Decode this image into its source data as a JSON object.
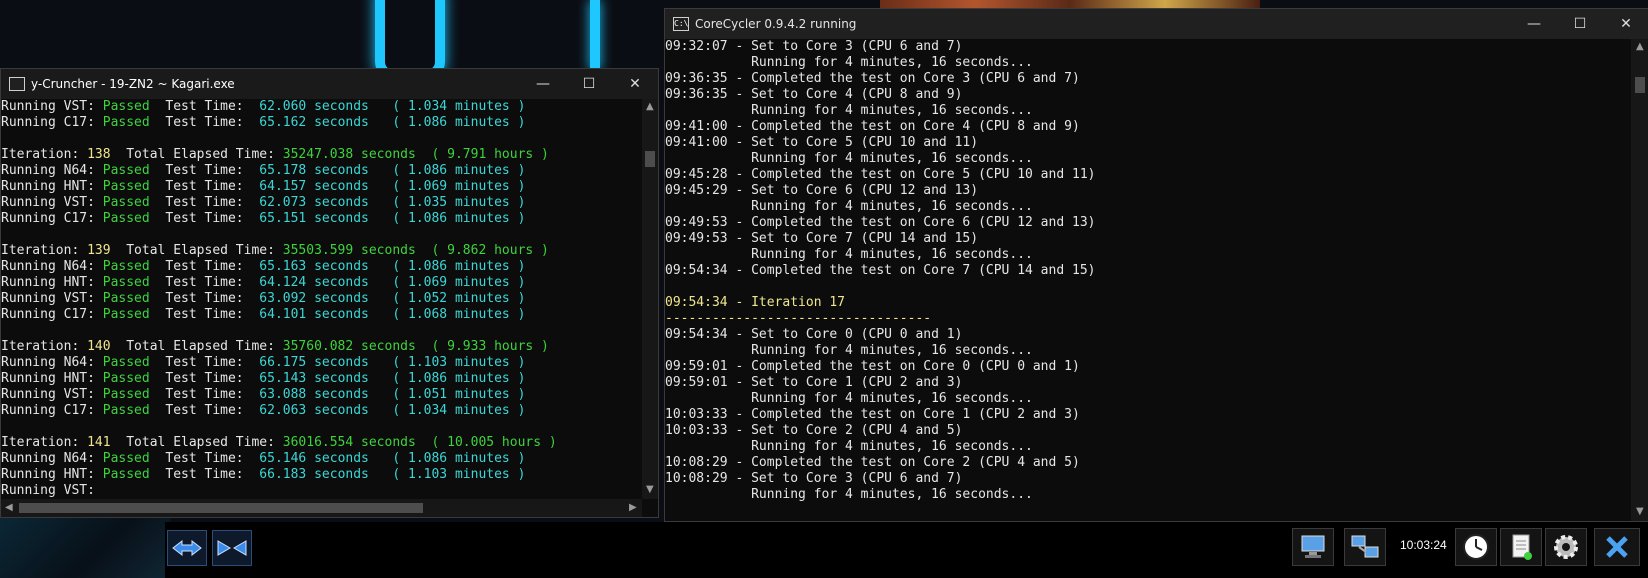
{
  "ycruncher": {
    "title": "y-Cruncher - 19-ZN2 ~ Kagari.exe",
    "lines": [
      [
        [
          "Running VST: ",
          "w"
        ],
        [
          "Passed",
          "g"
        ],
        [
          "  Test Time:  ",
          "w"
        ],
        [
          "62.060 seconds   ( 1.034 minutes )",
          "c"
        ]
      ],
      [
        [
          "Running C17: ",
          "w"
        ],
        [
          "Passed",
          "g"
        ],
        [
          "  Test Time:  ",
          "w"
        ],
        [
          "65.162 seconds   ( 1.086 minutes )",
          "c"
        ]
      ],
      [],
      [
        [
          "Iteration: ",
          "w"
        ],
        [
          "138",
          "y"
        ],
        [
          "  Total Elapsed Time: ",
          "w"
        ],
        [
          "35247.038 seconds",
          "g"
        ],
        [
          "  ( 9.791 hours )",
          "g"
        ]
      ],
      [
        [
          "Running N64: ",
          "w"
        ],
        [
          "Passed",
          "g"
        ],
        [
          "  Test Time:  ",
          "w"
        ],
        [
          "65.178 seconds   ( 1.086 minutes )",
          "c"
        ]
      ],
      [
        [
          "Running HNT: ",
          "w"
        ],
        [
          "Passed",
          "g"
        ],
        [
          "  Test Time:  ",
          "w"
        ],
        [
          "64.157 seconds   ( 1.069 minutes )",
          "c"
        ]
      ],
      [
        [
          "Running VST: ",
          "w"
        ],
        [
          "Passed",
          "g"
        ],
        [
          "  Test Time:  ",
          "w"
        ],
        [
          "62.073 seconds   ( 1.035 minutes )",
          "c"
        ]
      ],
      [
        [
          "Running C17: ",
          "w"
        ],
        [
          "Passed",
          "g"
        ],
        [
          "  Test Time:  ",
          "w"
        ],
        [
          "65.151 seconds   ( 1.086 minutes )",
          "c"
        ]
      ],
      [],
      [
        [
          "Iteration: ",
          "w"
        ],
        [
          "139",
          "y"
        ],
        [
          "  Total Elapsed Time: ",
          "w"
        ],
        [
          "35503.599 seconds",
          "g"
        ],
        [
          "  ( 9.862 hours )",
          "g"
        ]
      ],
      [
        [
          "Running N64: ",
          "w"
        ],
        [
          "Passed",
          "g"
        ],
        [
          "  Test Time:  ",
          "w"
        ],
        [
          "65.163 seconds   ( 1.086 minutes )",
          "c"
        ]
      ],
      [
        [
          "Running HNT: ",
          "w"
        ],
        [
          "Passed",
          "g"
        ],
        [
          "  Test Time:  ",
          "w"
        ],
        [
          "64.124 seconds   ( 1.069 minutes )",
          "c"
        ]
      ],
      [
        [
          "Running VST: ",
          "w"
        ],
        [
          "Passed",
          "g"
        ],
        [
          "  Test Time:  ",
          "w"
        ],
        [
          "63.092 seconds   ( 1.052 minutes )",
          "c"
        ]
      ],
      [
        [
          "Running C17: ",
          "w"
        ],
        [
          "Passed",
          "g"
        ],
        [
          "  Test Time:  ",
          "w"
        ],
        [
          "64.101 seconds   ( 1.068 minutes )",
          "c"
        ]
      ],
      [],
      [
        [
          "Iteration: ",
          "w"
        ],
        [
          "140",
          "y"
        ],
        [
          "  Total Elapsed Time: ",
          "w"
        ],
        [
          "35760.082 seconds",
          "g"
        ],
        [
          "  ( 9.933 hours )",
          "g"
        ]
      ],
      [
        [
          "Running N64: ",
          "w"
        ],
        [
          "Passed",
          "g"
        ],
        [
          "  Test Time:  ",
          "w"
        ],
        [
          "66.175 seconds   ( 1.103 minutes )",
          "c"
        ]
      ],
      [
        [
          "Running HNT: ",
          "w"
        ],
        [
          "Passed",
          "g"
        ],
        [
          "  Test Time:  ",
          "w"
        ],
        [
          "65.143 seconds   ( 1.086 minutes )",
          "c"
        ]
      ],
      [
        [
          "Running VST: ",
          "w"
        ],
        [
          "Passed",
          "g"
        ],
        [
          "  Test Time:  ",
          "w"
        ],
        [
          "63.088 seconds   ( 1.051 minutes )",
          "c"
        ]
      ],
      [
        [
          "Running C17: ",
          "w"
        ],
        [
          "Passed",
          "g"
        ],
        [
          "  Test Time:  ",
          "w"
        ],
        [
          "62.063 seconds   ( 1.034 minutes )",
          "c"
        ]
      ],
      [],
      [
        [
          "Iteration: ",
          "w"
        ],
        [
          "141",
          "y"
        ],
        [
          "  Total Elapsed Time: ",
          "w"
        ],
        [
          "36016.554 seconds",
          "g"
        ],
        [
          "  ( 10.005 hours )",
          "g"
        ]
      ],
      [
        [
          "Running N64: ",
          "w"
        ],
        [
          "Passed",
          "g"
        ],
        [
          "  Test Time:  ",
          "w"
        ],
        [
          "65.146 seconds   ( 1.086 minutes )",
          "c"
        ]
      ],
      [
        [
          "Running HNT: ",
          "w"
        ],
        [
          "Passed",
          "g"
        ],
        [
          "  Test Time:  ",
          "w"
        ],
        [
          "66.183 seconds   ( 1.103 minutes )",
          "c"
        ]
      ],
      [
        [
          "Running VST: ",
          "w"
        ]
      ]
    ]
  },
  "corecycler": {
    "title": "CoreCycler 0.9.4.2 running",
    "lines": [
      [
        [
          "09:32:07 - Set to Core 3 (CPU 6 and 7)",
          "w"
        ]
      ],
      [
        [
          "           Running for 4 minutes, 16 seconds...",
          "w"
        ]
      ],
      [
        [
          "09:36:35 - Completed the test on Core 3 (CPU 6 and 7)",
          "w"
        ]
      ],
      [
        [
          "09:36:35 - Set to Core 4 (CPU 8 and 9)",
          "w"
        ]
      ],
      [
        [
          "           Running for 4 minutes, 16 seconds...",
          "w"
        ]
      ],
      [
        [
          "09:41:00 - Completed the test on Core 4 (CPU 8 and 9)",
          "w"
        ]
      ],
      [
        [
          "09:41:00 - Set to Core 5 (CPU 10 and 11)",
          "w"
        ]
      ],
      [
        [
          "           Running for 4 minutes, 16 seconds...",
          "w"
        ]
      ],
      [
        [
          "09:45:28 - Completed the test on Core 5 (CPU 10 and 11)",
          "w"
        ]
      ],
      [
        [
          "09:45:29 - Set to Core 6 (CPU 12 and 13)",
          "w"
        ]
      ],
      [
        [
          "           Running for 4 minutes, 16 seconds...",
          "w"
        ]
      ],
      [
        [
          "09:49:53 - Completed the test on Core 6 (CPU 12 and 13)",
          "w"
        ]
      ],
      [
        [
          "09:49:53 - Set to Core 7 (CPU 14 and 15)",
          "w"
        ]
      ],
      [
        [
          "           Running for 4 minutes, 16 seconds...",
          "w"
        ]
      ],
      [
        [
          "09:54:34 - Completed the test on Core 7 (CPU 14 and 15)",
          "w"
        ]
      ],
      [],
      [
        [
          "09:54:34 - Iteration 17",
          "y"
        ]
      ],
      [
        [
          "----------------------------------",
          "y"
        ]
      ],
      [
        [
          "09:54:34 - Set to Core 0 (CPU 0 and 1)",
          "w"
        ]
      ],
      [
        [
          "           Running for 4 minutes, 16 seconds...",
          "w"
        ]
      ],
      [
        [
          "09:59:01 - Completed the test on Core 0 (CPU 0 and 1)",
          "w"
        ]
      ],
      [
        [
          "09:59:01 - Set to Core 1 (CPU 2 and 3)",
          "w"
        ]
      ],
      [
        [
          "           Running for 4 minutes, 16 seconds...",
          "w"
        ]
      ],
      [
        [
          "10:03:33 - Completed the test on Core 1 (CPU 2 and 3)",
          "w"
        ]
      ],
      [
        [
          "10:03:33 - Set to Core 2 (CPU 4 and 5)",
          "w"
        ]
      ],
      [
        [
          "           Running for 4 minutes, 16 seconds...",
          "w"
        ]
      ],
      [
        [
          "10:08:29 - Completed the test on Core 2 (CPU 4 and 5)",
          "w"
        ]
      ],
      [
        [
          "10:08:29 - Set to Core 3 (CPU 6 and 7)",
          "w"
        ]
      ],
      [
        [
          "           Running for 4 minutes, 16 seconds...",
          "w"
        ]
      ]
    ]
  },
  "taskbar": {
    "clock": "10:03:24",
    "left_buttons": [
      "expand-arrows-icon",
      "collapse-arrows-icon"
    ],
    "tray_icons": [
      "remote-desktop-icon",
      "network-computers-icon",
      "clock-icon",
      "notes-icon",
      "gear-icon",
      "close-x-icon"
    ]
  },
  "colors": {
    "green": "#3ed33e",
    "cyan": "#3dd6d6",
    "yellow": "#f0e68c",
    "gray": "#cccccc"
  }
}
